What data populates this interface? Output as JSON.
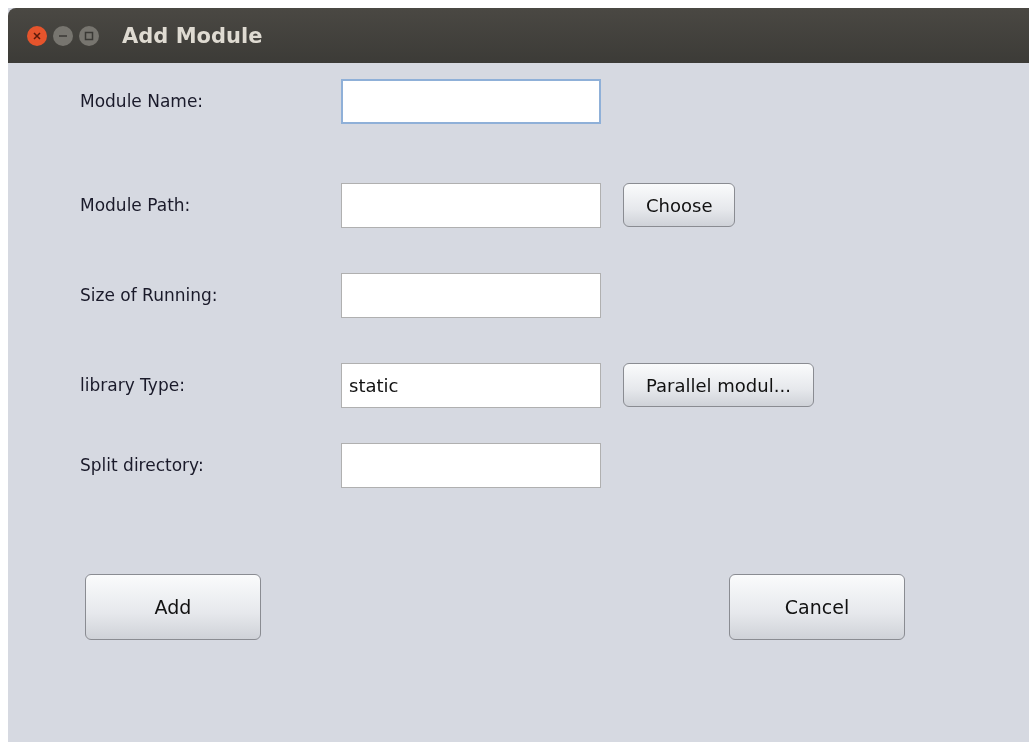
{
  "window": {
    "title": "Add Module"
  },
  "fields": [
    {
      "label": "Module Name:",
      "focused": true
    },
    {
      "label": "Module Path:",
      "focused": false,
      "button": "Choose"
    },
    {
      "label": "Size of Running:",
      "focused": false
    },
    {
      "label": "library Type:",
      "value": "static",
      "focused": false,
      "button": "Parallel modul..."
    },
    {
      "label": "Split directory:",
      "focused": false
    }
  ],
  "buttons": [
    "Add",
    "Cancel"
  ]
}
